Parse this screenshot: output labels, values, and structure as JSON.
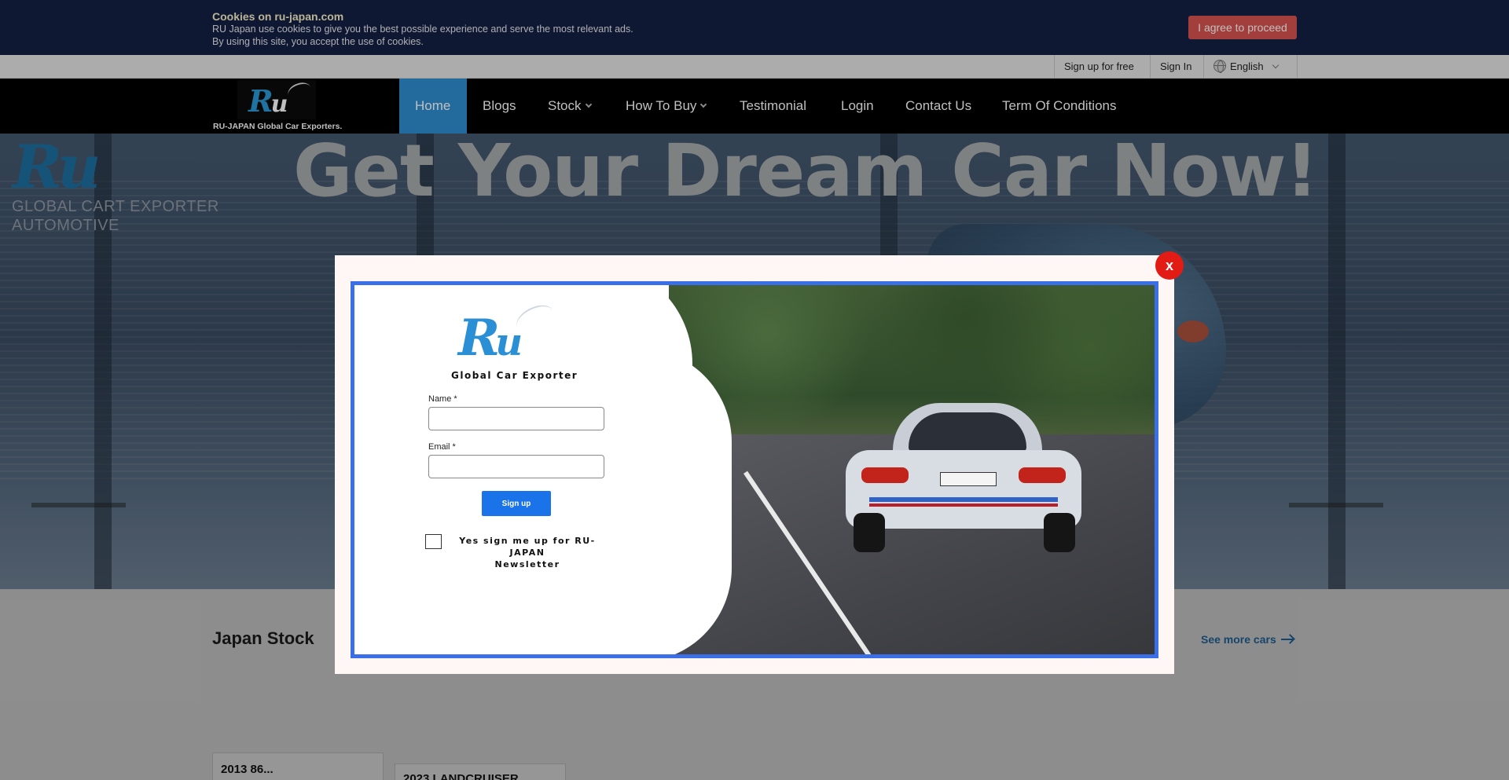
{
  "cookie": {
    "title": "Cookies on ru-japan.com",
    "line1": "RU Japan use cookies to give you the best possible experience and serve the most relevant ads.",
    "line2": "By using this site, you accept the use of cookies.",
    "button": "I agree to proceed"
  },
  "topbar": {
    "signup": "Sign up for free",
    "signin": "Sign In",
    "language": "English",
    "language_icon": "globe-icon"
  },
  "nav": {
    "brand_caption": "RU-JAPAN Global Car Exporters.",
    "items": [
      "Home",
      "Blogs",
      "Stock",
      "How To Buy",
      "Testimonial",
      "Login",
      "Contact Us",
      "Term Of Conditions"
    ],
    "active": "Home"
  },
  "hero": {
    "title": "Get Your Dream Car Now!",
    "logo_line1": "GLOBAL CART EXPORTER",
    "logo_line2": "AUTOMOTIVE"
  },
  "stock": {
    "title": "Japan Stock",
    "see_more": "See more cars",
    "cards": [
      "2013 86...",
      "2023 LANDCRUISER..."
    ]
  },
  "modal": {
    "close": "x",
    "caption": "Global Car Exporter",
    "name_label": "Name *",
    "email_label": "Email *",
    "submit": "Sign up",
    "newsletter_line1": "Yes sign me up for  RU-JAPAN",
    "newsletter_line2": "Newsletter"
  },
  "colors": {
    "cookie_bg": "#152044",
    "accept_btn": "#d9534f",
    "nav_active": "#2f8fd0",
    "modal_border": "#3a6fe8",
    "close_btn": "#e21b14",
    "signup_btn": "#1a73e8"
  }
}
